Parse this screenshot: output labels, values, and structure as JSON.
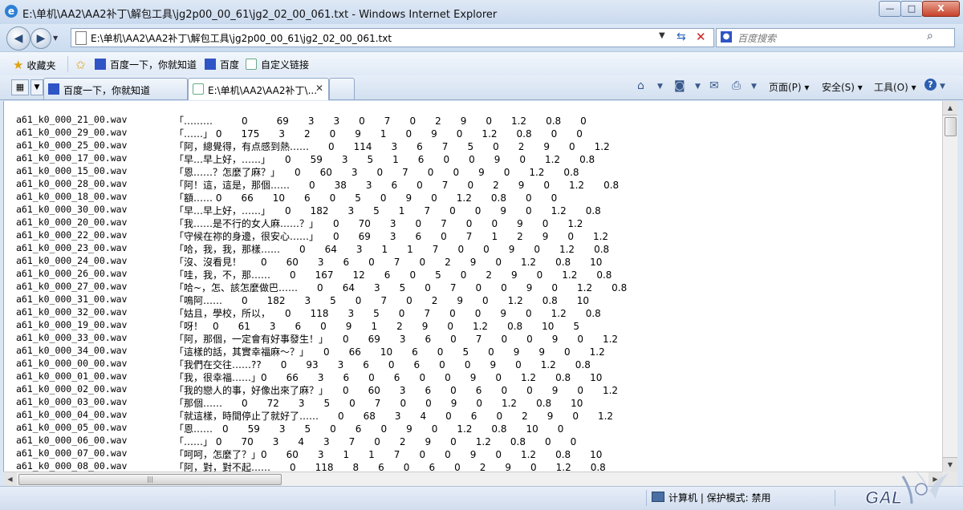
{
  "window": {
    "title": "E:\\单机\\AA2\\AA2补丁\\解包工具\\jg2p00_00_61\\jg2_02_00_061.txt - Windows Internet Explorer",
    "min_label": "—",
    "max_label": "□",
    "close_label": "X"
  },
  "nav": {
    "address": "E:\\单机\\AA2\\AA2补丁\\解包工具\\jg2p00_00_61\\jg2_02_00_061.txt",
    "search_placeholder": "百度搜索"
  },
  "favorites": {
    "favorites_label": "收藏夹",
    "items": [
      {
        "label": "百度一下，你就知道"
      },
      {
        "label": "百度"
      },
      {
        "label": "自定义链接"
      }
    ]
  },
  "tabs": [
    {
      "label": "百度一下，你就知道"
    },
    {
      "label": "E:\\单机\\AA2\\AA2补丁\\..."
    }
  ],
  "commandbar": {
    "page": "页面(P)",
    "safety": "安全(S)",
    "tools": "工具(O)",
    "help": "?"
  },
  "file_lines": [
    {
      "file": "a61_k0_000_21_00.wav",
      "text": "「………　　　0　　　69　　3　　3　　0　　7　　0　　2　　9　　0　　1.2　　0.8　　0"
    },
    {
      "file": "a61_k0_000_29_00.wav",
      "text": "「……」 0　　175　　3　　2　　0　　9　　1　　0　　9　　0　　1.2　　0.8　　0　　0"
    },
    {
      "file": "a61_k0_000_25_00.wav",
      "text": "「阿，總覺得，有点感到熱……　　0　　114　　3　　6　　7　　5　　0　　2　　9　　0　　1.2"
    },
    {
      "file": "a61_k0_000_17_00.wav",
      "text": "「早…早上好，……」　　0　　59　　3　　5　　1　　6　　0　　0　　9　　0　　1.2　　0.8"
    },
    {
      "file": "a61_k0_000_15_00.wav",
      "text": "「恩……？怎麼了麻？」　　0　　60　　3　　0　　7　　0　　0　　9　　0　　1.2　　0.8"
    },
    {
      "file": "a61_k0_000_28_00.wav",
      "text": "「阿！這，這是，那個……　　0　　38　　3　　6　　0　　7　　0　　2　　9　　0　　1.2　　0.8"
    },
    {
      "file": "a61_k0_000_18_00.wav",
      "text": "「額…… 0　　66　　10　　6　　0　　5　　0　　9　　0　　1.2　　0.8　　0　　0"
    },
    {
      "file": "a61_k0_000_30_00.wav",
      "text": "「早…早上好，……」　　0　　182　　3　　5　　1　　7　　0　　0　　9　　0　　1.2　　0.8"
    },
    {
      "file": "a61_k0_000_20_00.wav",
      "text": "「我……是不行的女人麻……？」　　0　　70　　3　　0　　7　　0　　0　　9　　0　　1.2"
    },
    {
      "file": "a61_k0_000_22_00.wav",
      "text": "「守候在祢的身邊，很安心……」　　0　　69　　3　　6　　0　　7　　1　　2　　9　　0　　1.2"
    },
    {
      "file": "a61_k0_000_23_00.wav",
      "text": "「哈，我，我，那樣……　　0　　64　　3　　1　　1　　7　　0　　0　　9　　0　　1.2　　0.8"
    },
    {
      "file": "a61_k0_000_24_00.wav",
      "text": "「沒、沒看見！　　0　　60　　3　　6　　0　　7　　0　　2　　9　　0　　1.2　　0.8　　10"
    },
    {
      "file": "a61_k0_000_26_00.wav",
      "text": "「哇，我，不，那……　　0　　167　　12　　6　　0　　5　　0　　2　　9　　0　　1.2　　0.8"
    },
    {
      "file": "a61_k0_000_27_00.wav",
      "text": "「哈~，怎、該怎麼做巴……　　0　　64　　3　　5　　0　　7　　0　　0　　9　　0　　1.2　　0.8"
    },
    {
      "file": "a61_k0_000_31_00.wav",
      "text": "「鳴阿……　　0　　182　　3　　5　　0　　7　　0　　2　　9　　0　　1.2　　0.8　　10"
    },
    {
      "file": "a61_k0_000_32_00.wav",
      "text": "「姑且，學校，所以，　　0　　118　　3　　5　　0　　7　　0　　0　　9　　0　　1.2　　0.8"
    },
    {
      "file": "a61_k0_000_19_00.wav",
      "text": "「呀！　0　　61　　3　　6　　0　　9　　1　　2　　9　　0　　1.2　　0.8　　10　　5"
    },
    {
      "file": "a61_k0_000_33_00.wav",
      "text": "「阿，那個，一定會有好事發生！」　　0　　69　　3　　6　　0　　7　　0　　0　　9　　0　　1.2"
    },
    {
      "file": "a61_k0_000_34_00.wav",
      "text": "「這樣的話，其實幸福麻～？」　　0　　66　　10　　6　　0　　5　　0　　9　　9　　0　　1.2"
    },
    {
      "file": "a61_k0_000_00_00.wav",
      "text": "「我們在交往……??　　0　　93　　3　　6　　0　　6　　0　　0　　9　　0　　1.2　　0.8"
    },
    {
      "file": "a61_k0_000_01_00.wav",
      "text": "「我，很幸福……」0　　66　　3　　6　　0　　6　　0　　0　　9　　0　　1.2　　0.8　　10"
    },
    {
      "file": "a61_k0_000_02_00.wav",
      "text": "「我的戀人的事，好像出來了麻？」　　0　　60　　3　　6　　0　　6　　0　　0　　9　　0　　1.2"
    },
    {
      "file": "a61_k0_000_03_00.wav",
      "text": "「那個……　　0　　72　　3　　5　　0　　7　　0　　0　　9　　0　　1.2　　0.8　　10"
    },
    {
      "file": "a61_k0_000_04_00.wav",
      "text": "「就這樣，時間停止了就好了……　　0　　68　　3　　4　　0　　6　　0　　2　　9　　0　　1.2"
    },
    {
      "file": "a61_k0_000_05_00.wav",
      "text": "「恩……　0　　59　　3　　5　　0　　6　　0　　9　　0　　1.2　　0.8　　10　　0"
    },
    {
      "file": "a61_k0_000_06_00.wav",
      "text": "「……」 0　　70　　3　　4　　3　　7　　0　　2　　9　　0　　1.2　　0.8　　0　　0"
    },
    {
      "file": "a61_k0_000_07_00.wav",
      "text": "「呵呵，怎麼了？」0　　60　　3　　1　　1　　7　　0　　0　　9　　0　　1.2　　0.8　　10"
    },
    {
      "file": "a61_k0_000_08_00.wav",
      "text": "「阿，對，對不起……　　0　　118　　8　　6　　0　　6　　0　　2　　9　　0　　1.2　　0.8"
    }
  ],
  "status": {
    "zone": "计算机 | 保护模式: 禁用",
    "watermark": "GAL"
  },
  "icons": {
    "back": "back-arrow-icon",
    "forward": "forward-arrow-icon",
    "refresh": "refresh-icon",
    "stop": "stop-icon",
    "search": "magnifier-icon",
    "home": "home-icon",
    "feeds": "rss-icon",
    "mail": "mail-icon",
    "print": "printer-icon",
    "help": "help-icon"
  }
}
